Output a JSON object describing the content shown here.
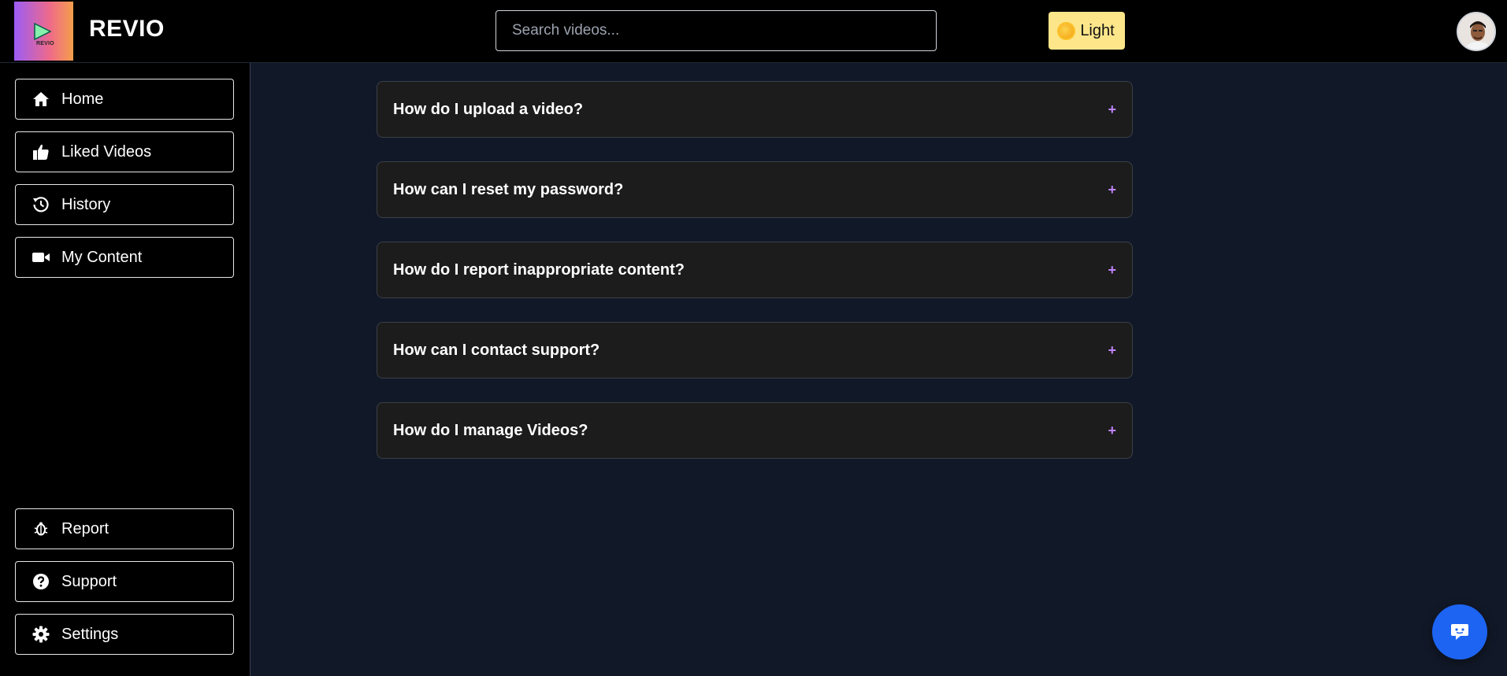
{
  "header": {
    "logo_mini_text": "REVIO",
    "brand": "REVIO",
    "search_placeholder": "Search videos...",
    "theme_label": "Light"
  },
  "sidebar": {
    "top_items": [
      {
        "label": "Home",
        "icon": "home-icon"
      },
      {
        "label": "Liked Videos",
        "icon": "thumbs-up-icon"
      },
      {
        "label": "History",
        "icon": "history-icon"
      },
      {
        "label": "My Content",
        "icon": "video-camera-icon"
      }
    ],
    "bottom_items": [
      {
        "label": "Report",
        "icon": "bug-icon"
      },
      {
        "label": "Support",
        "icon": "question-circle-icon"
      },
      {
        "label": "Settings",
        "icon": "gear-icon"
      }
    ]
  },
  "faq": {
    "items": [
      {
        "question": "How do I upload a video?",
        "toggle": "+"
      },
      {
        "question": "How can I reset my password?",
        "toggle": "+"
      },
      {
        "question": "How do I report inappropriate content?",
        "toggle": "+"
      },
      {
        "question": "How can I contact support?",
        "toggle": "+"
      },
      {
        "question": "How do I manage Videos?",
        "toggle": "+"
      }
    ]
  },
  "colors": {
    "accent_plus": "#c084fc",
    "theme_button_bg": "#fde68a",
    "chat_button_bg": "#1d64f2",
    "page_bg": "#111827"
  }
}
